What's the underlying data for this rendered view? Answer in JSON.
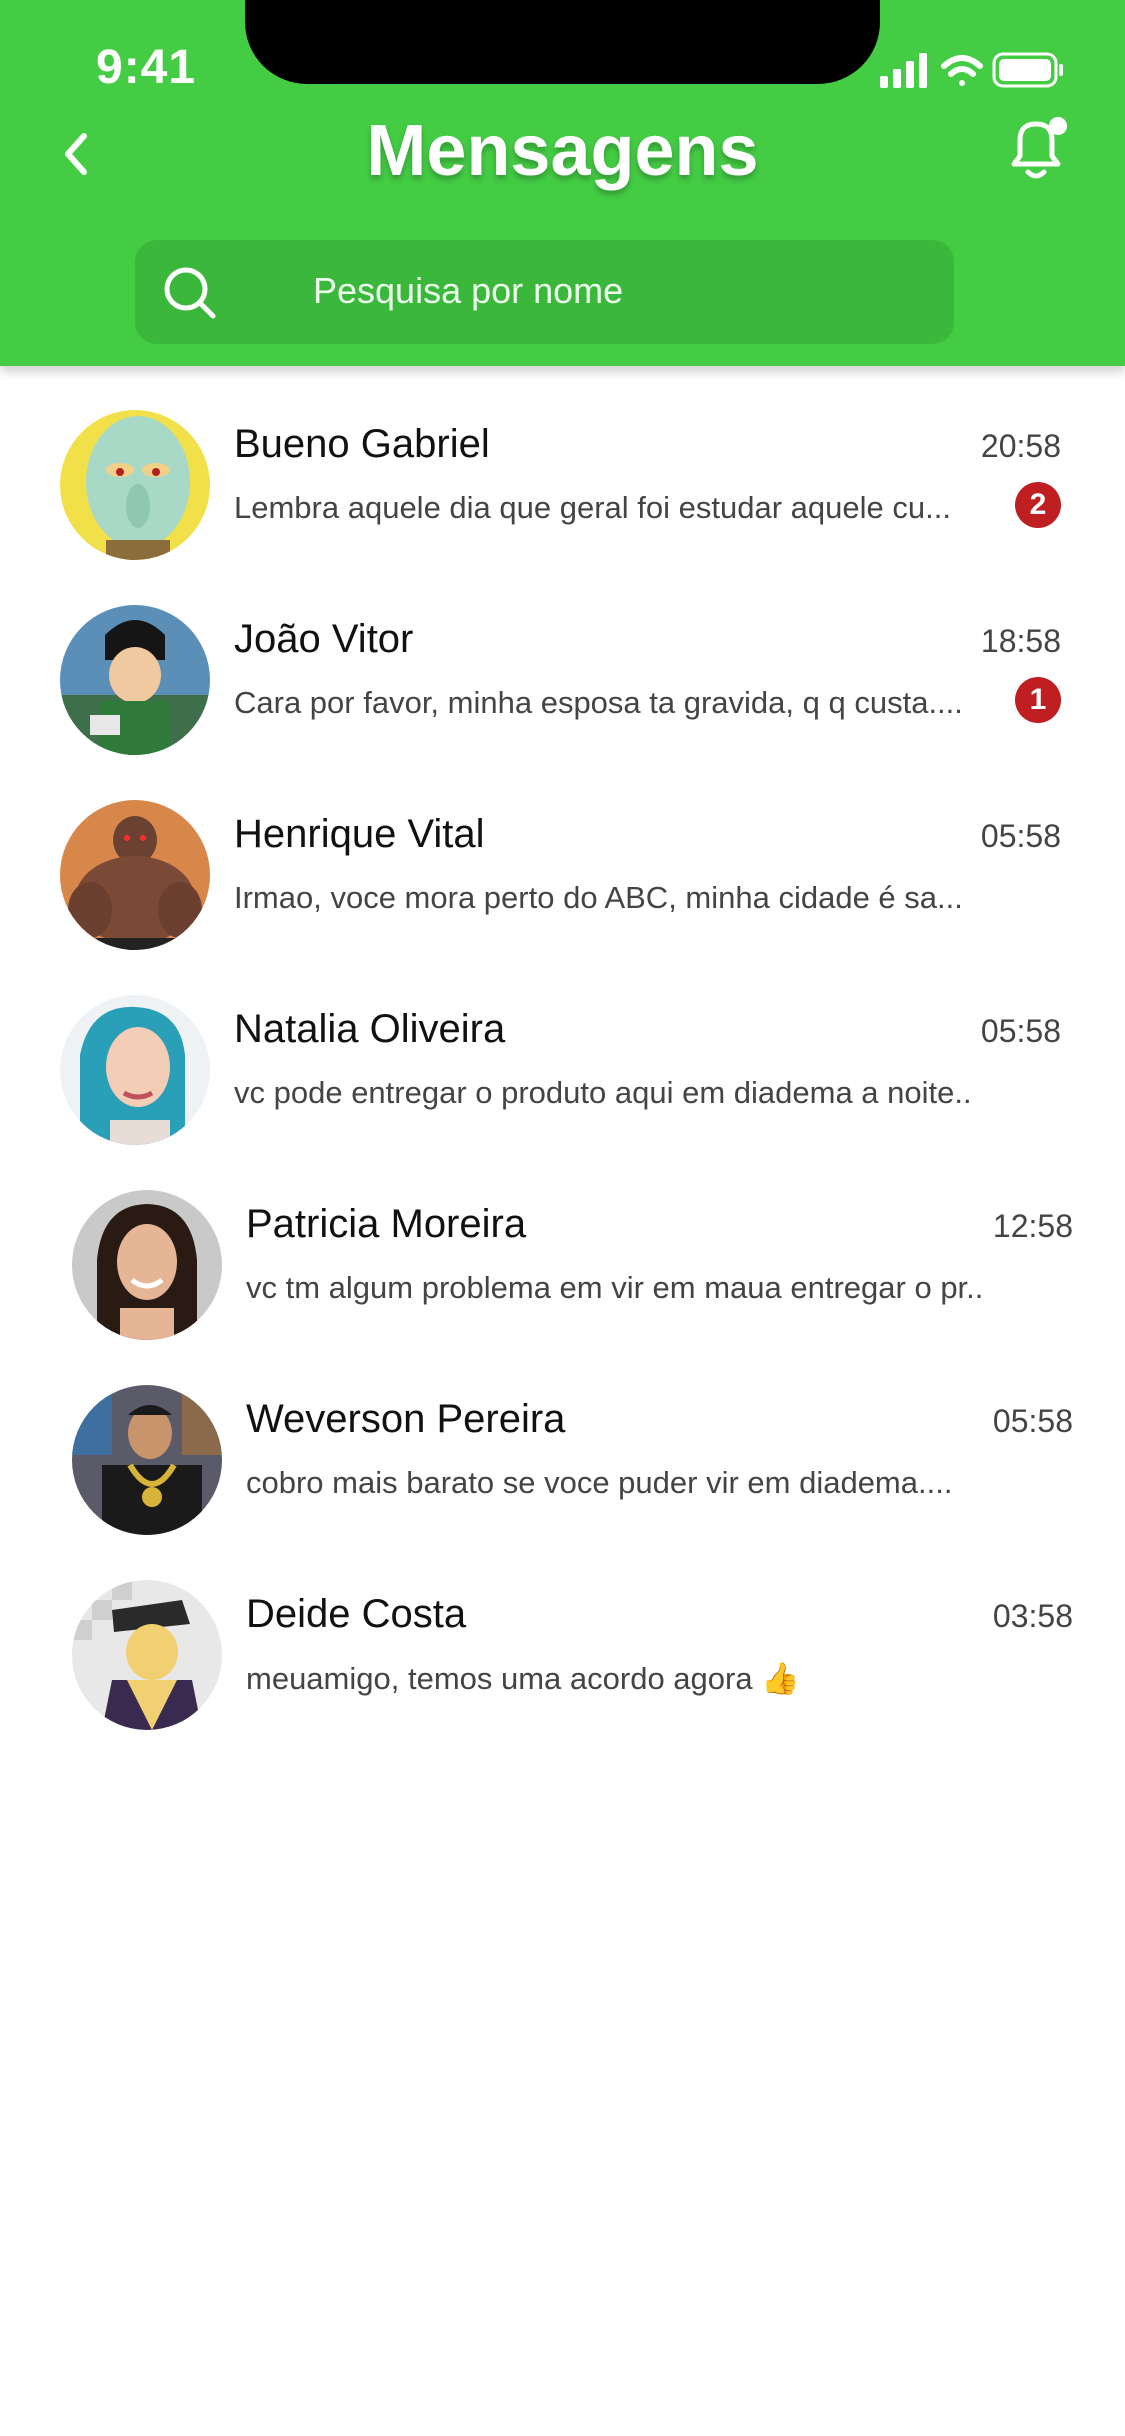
{
  "status_bar": {
    "time": "9:41"
  },
  "header": {
    "title": "Mensagens"
  },
  "search": {
    "placeholder": "Pesquisa por nome"
  },
  "colors": {
    "header_green": "#44cc44",
    "search_bg": "#3bb83b",
    "badge_red": "#c01f22"
  },
  "conversations": [
    {
      "name": "Bueno Gabriel",
      "time": "20:58",
      "preview": "Lembra aquele dia que geral foi estudar aquele cu...",
      "unread": "2",
      "avatar": "squidward-avatar"
    },
    {
      "name": "João Vitor",
      "time": "18:58",
      "preview": "Cara por favor, minha esposa ta gravida, q q custa....",
      "unread": "1",
      "avatar": "anime-ninja-avatar"
    },
    {
      "name": "Henrique Vital",
      "time": "05:58",
      "preview": "Irmao, voce mora perto do ABC, minha cidade é sa...",
      "unread": "",
      "avatar": "muscle-character-avatar"
    },
    {
      "name": "Natalia Oliveira",
      "time": "05:58",
      "preview": "vc pode entregar o produto aqui em diadema a noite...",
      "unread": "",
      "avatar": "woman-blue-hair-avatar"
    },
    {
      "name": "Patricia Moreira",
      "time": "12:58",
      "preview": "vc tm algum problema em vir em maua entregar o pr...",
      "unread": "",
      "avatar": "woman-smiling-avatar"
    },
    {
      "name": "Weverson Pereira",
      "time": "05:58",
      "preview": "cobro mais barato se voce puder vir em diadema....",
      "unread": "",
      "avatar": "man-gold-chain-avatar"
    },
    {
      "name": "Deide Costa",
      "time": "03:58",
      "preview": "meuamigo, temos uma acordo agora 👍",
      "unread": "",
      "avatar": "jojo-character-avatar"
    }
  ]
}
